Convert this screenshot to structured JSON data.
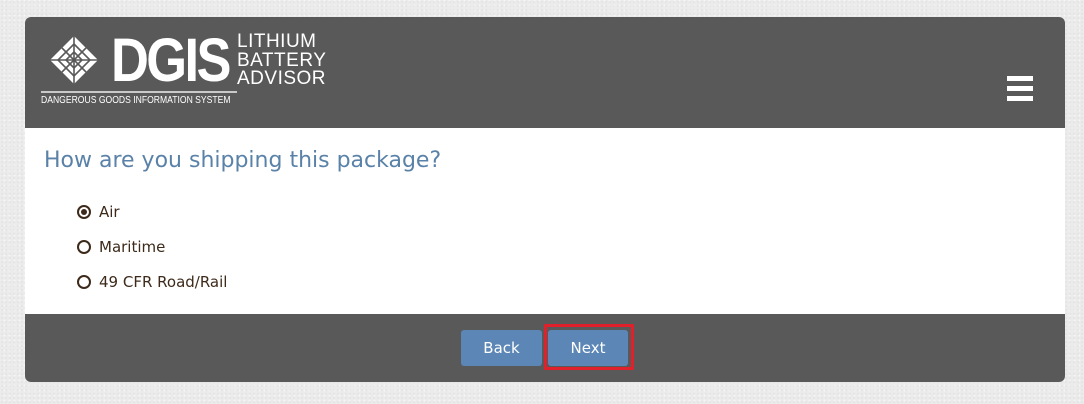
{
  "header": {
    "logo": {
      "wordmark": "DGIS",
      "product_lines": [
        "LITHIUM",
        "BATTERY",
        "ADVISOR"
      ],
      "tagline": "DANGEROUS GOODS INFORMATION SYSTEM"
    },
    "menu_icon": "hamburger-menu-icon"
  },
  "main": {
    "question": "How are you shipping this package?",
    "options": [
      {
        "label": "Air",
        "selected": true
      },
      {
        "label": "Maritime",
        "selected": false
      },
      {
        "label": "49 CFR Road/Rail",
        "selected": false
      }
    ]
  },
  "footer": {
    "back_label": "Back",
    "next_label": "Next"
  },
  "colors": {
    "header_bg": "#595959",
    "question_text": "#5a82a8",
    "button_bg": "#5b86b5",
    "highlight": "#e0202a",
    "option_text": "#3d2a1a"
  }
}
